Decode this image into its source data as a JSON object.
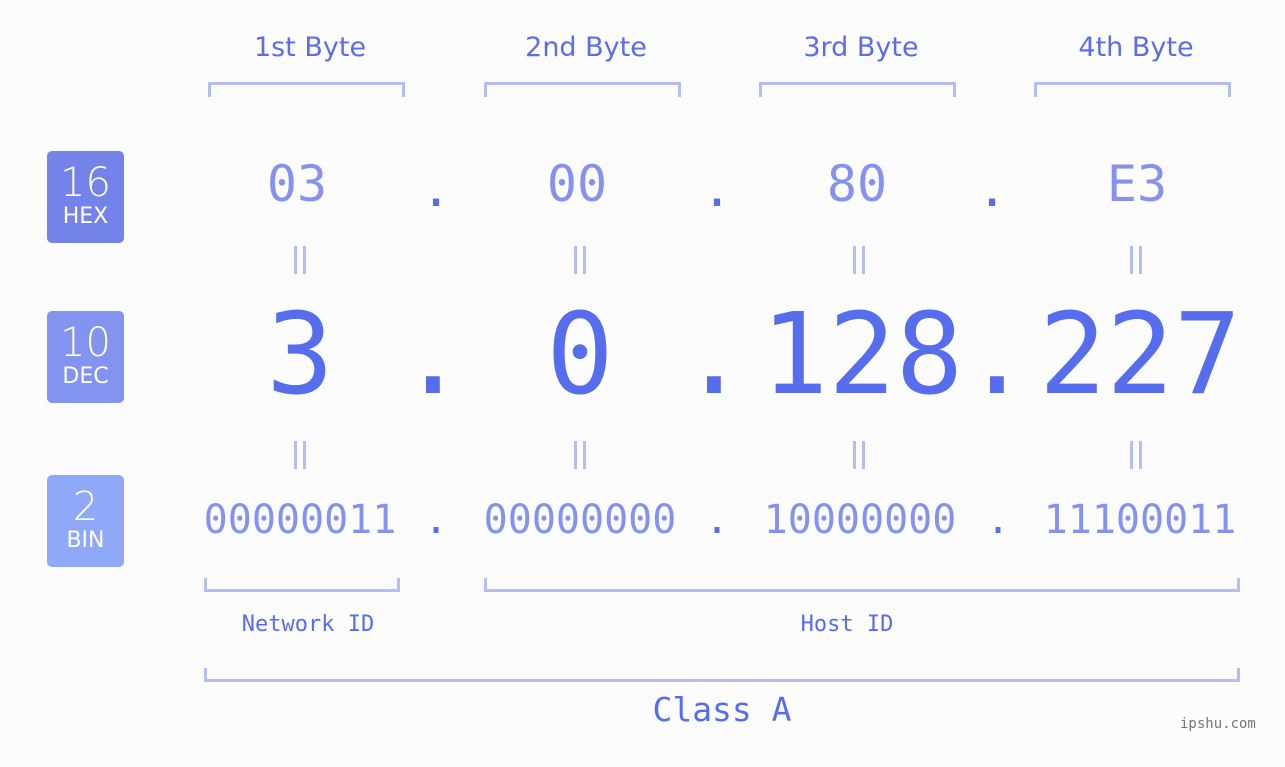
{
  "badges": [
    {
      "number": "16",
      "label": "HEX",
      "color": "#7383ea"
    },
    {
      "number": "10",
      "label": "DEC",
      "color": "#8393f0"
    },
    {
      "number": "2",
      "label": "BIN",
      "color": "#8fa8f8"
    }
  ],
  "byte_headers": [
    "1st Byte",
    "2nd Byte",
    "3rd Byte",
    "4th Byte"
  ],
  "hex": [
    "03",
    "00",
    "80",
    "E3"
  ],
  "dec": [
    "3",
    "0",
    "128",
    "227"
  ],
  "bin": [
    "00000011",
    "00000000",
    "10000000",
    "11100011"
  ],
  "separator": ".",
  "network_label": "Network ID",
  "host_label": "Host ID",
  "class_label": "Class A",
  "watermark": "ipshu.com",
  "colors": {
    "accent": "#566ded",
    "light": "#8593ee",
    "bracket": "#b3bdf6"
  }
}
